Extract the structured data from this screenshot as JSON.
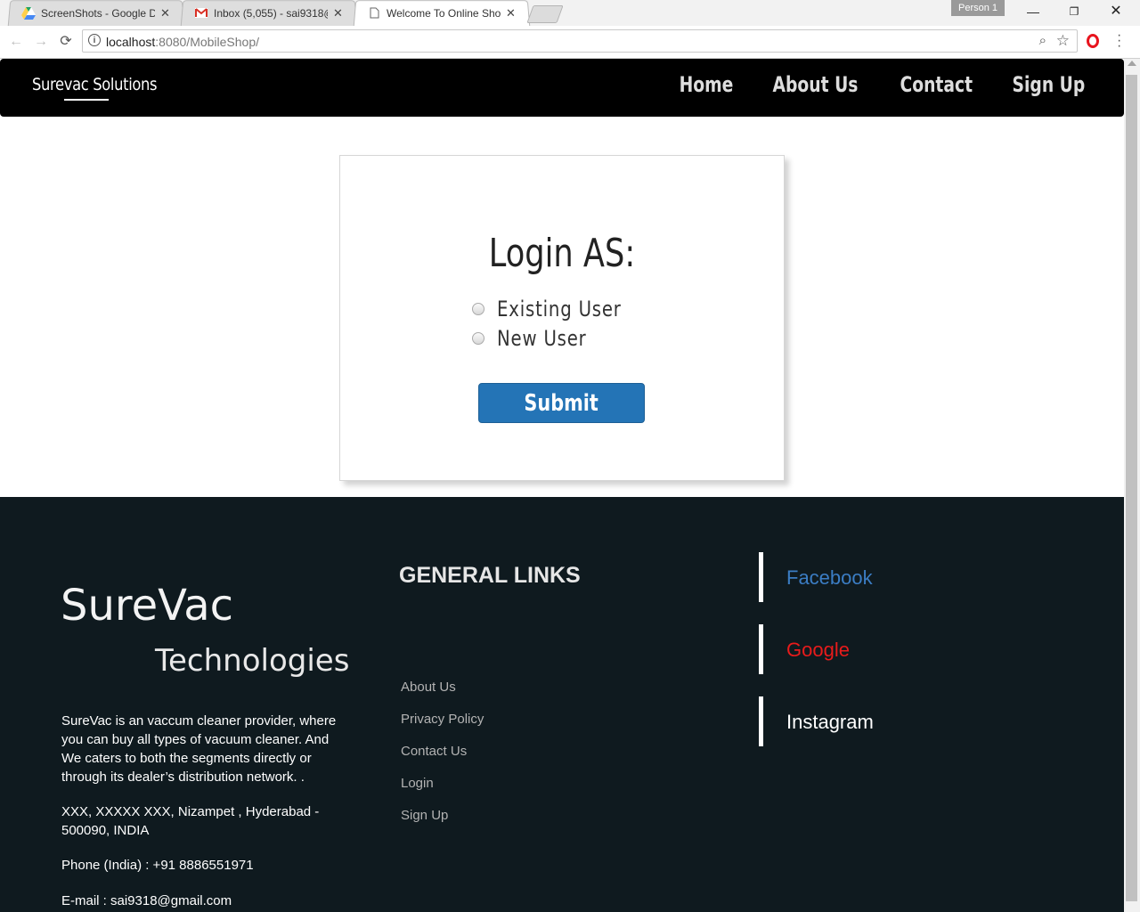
{
  "browser": {
    "tabs": [
      {
        "title": "ScreenShots - Google Dr",
        "icon": "google-drive-icon"
      },
      {
        "title": "Inbox (5,055) - sai9318@",
        "icon": "gmail-icon"
      },
      {
        "title": "Welcome To Online Shop",
        "icon": "page-icon"
      }
    ],
    "profile": "Person 1",
    "url_host": "localhost",
    "url_path": ":8080/MobileShop/"
  },
  "site": {
    "brand": "Surevac Solutions",
    "nav": [
      "Home",
      "About Us",
      "Contact",
      "Sign Up"
    ]
  },
  "login": {
    "title": "Login AS:",
    "options": [
      "Existing User",
      "New User"
    ],
    "submit": "Submit"
  },
  "footer": {
    "logo_line1": "SureVac",
    "logo_line2": "Technologies",
    "about": "SureVac is an vaccum cleaner provider, where you can buy all types of vacuum cleaner. And We caters to both the segments directly or through its dealer’s distribution network. .",
    "address": "XXX, XXXXX XXX, Nizampet , Hyderabad - 500090, INDIA",
    "phone": "Phone (India) : +91 8886551971",
    "email": "E-mail : sai9318@gmail.com",
    "links_heading": "GENERAL LINKS",
    "links": [
      "About Us",
      "Privacy Policy",
      "Contact Us",
      "Login",
      "Sign Up"
    ],
    "social": [
      {
        "label": "Facebook",
        "color": "#3b7dc4"
      },
      {
        "label": "Google",
        "color": "#e81b1b"
      },
      {
        "label": "Instagram",
        "color": "#ffffff"
      }
    ]
  }
}
